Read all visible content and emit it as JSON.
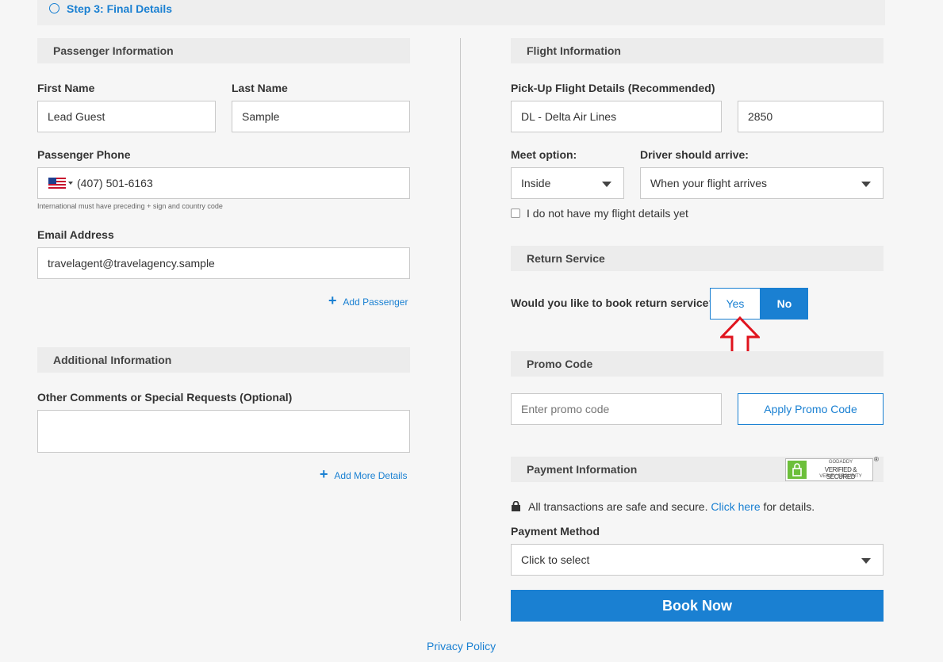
{
  "step": {
    "label": "Step 3: Final Details"
  },
  "passenger": {
    "section_title": "Passenger Information",
    "first_name_label": "First Name",
    "first_name_value": "Lead Guest",
    "last_name_label": "Last Name",
    "last_name_value": "Sample",
    "phone_label": "Passenger Phone",
    "phone_value": "(407) 501-6163",
    "phone_hint": "International must have preceding + sign and country code",
    "email_label": "Email Address",
    "email_value": "travelagent@travelagency.sample",
    "add_passenger": "Add Passenger"
  },
  "additional": {
    "section_title": "Additional Information",
    "comments_label": "Other Comments or Special Requests (Optional)",
    "comments_value": "",
    "add_more": "Add More Details"
  },
  "flight": {
    "section_title": "Flight Information",
    "pickup_label": "Pick-Up Flight Details (Recommended)",
    "airline_value": "DL - Delta Air Lines",
    "flight_number_value": "2850",
    "meet_label": "Meet option:",
    "meet_value": "Inside",
    "driver_label": "Driver should arrive:",
    "driver_value": "When your flight arrives",
    "no_details_label": "I do not have my flight details yet"
  },
  "return_service": {
    "section_title": "Return Service",
    "question": "Would you like to book return service?",
    "yes_label": "Yes",
    "no_label": "No",
    "selected": "No"
  },
  "promo": {
    "section_title": "Promo Code",
    "placeholder": "Enter promo code",
    "apply_label": "Apply Promo Code"
  },
  "payment": {
    "section_title": "Payment Information",
    "badge_top": "GODADDY",
    "badge_main": "VERIFIED & SECURED",
    "badge_sub": "VERIFY SECURITY",
    "secure_text_before": "All transactions are safe and secure.",
    "secure_link": "Click here",
    "secure_text_after": "for details.",
    "method_label": "Payment Method",
    "method_value": "Click to select",
    "book_label": "Book Now"
  },
  "footer": {
    "privacy": "Privacy Policy"
  },
  "colors": {
    "accent": "#1a80d2",
    "arrow": "#e0141e",
    "badge_green": "#6cbf3a"
  }
}
